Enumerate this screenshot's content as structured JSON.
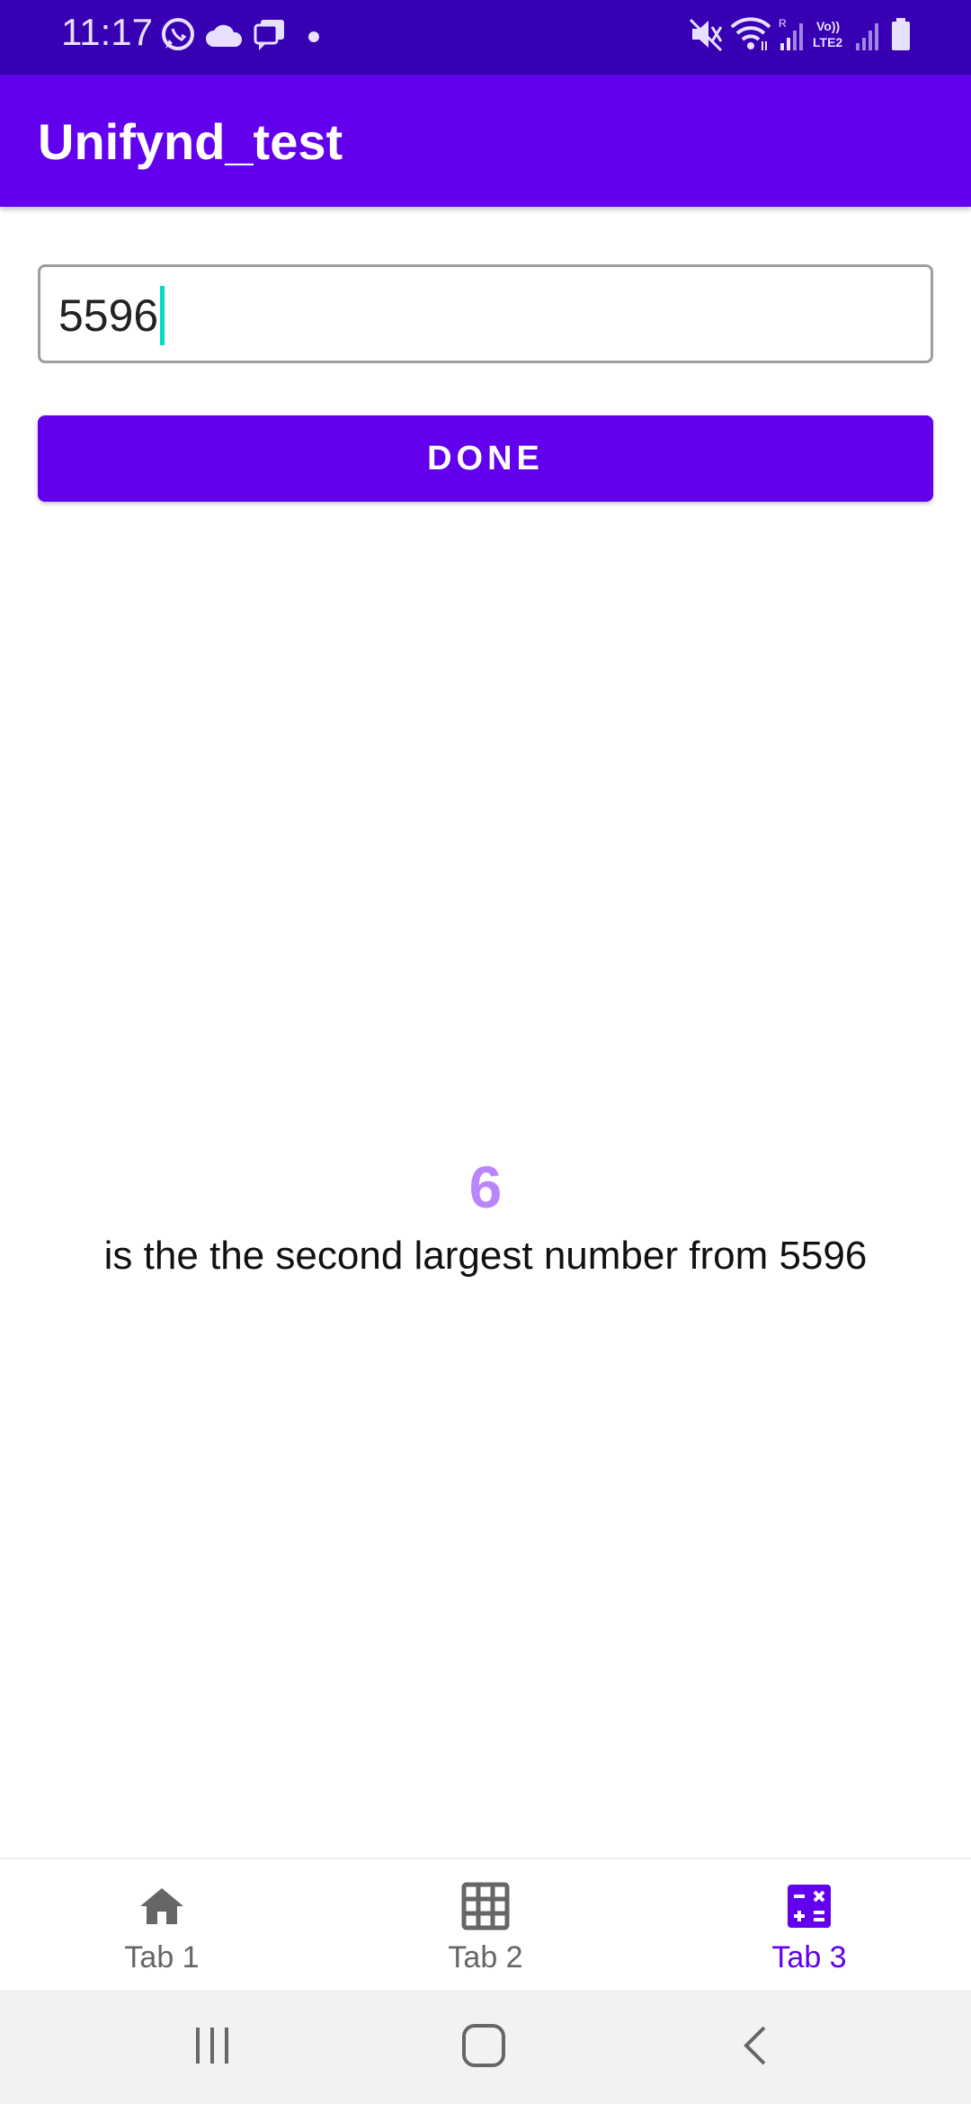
{
  "status_bar": {
    "time": "11:17",
    "icons": [
      "whatsapp-icon",
      "cloud-icon",
      "chat-icon",
      "mute-icon",
      "wifi-icon",
      "signal-icon",
      "volte-icon",
      "signal-icon",
      "battery-icon"
    ],
    "network_label": "Vo)) LTE2",
    "roaming_label": "R"
  },
  "app_bar": {
    "title": "Unifynd_test"
  },
  "input": {
    "value": "5596"
  },
  "done_button": {
    "label": "DONE"
  },
  "result": {
    "number": "6",
    "text": "is the the second largest number from 5596"
  },
  "bottom_nav": {
    "items": [
      {
        "label": "Tab 1",
        "icon": "home-icon",
        "active": false
      },
      {
        "label": "Tab 2",
        "icon": "grid-icon",
        "active": false
      },
      {
        "label": "Tab 3",
        "icon": "calculator-icon",
        "active": true
      }
    ]
  },
  "colors": {
    "primary": "#6200ee",
    "primary_dark": "#3700b3",
    "accent_light": "#bb86fc",
    "caret": "#03dac5"
  }
}
